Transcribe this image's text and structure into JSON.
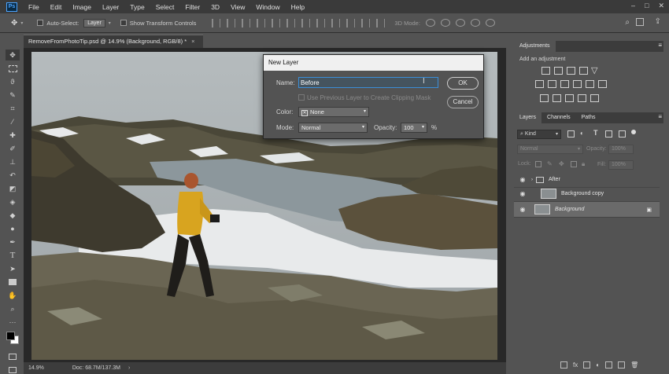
{
  "menubar": {
    "logo": "Ps",
    "items": [
      "File",
      "Edit",
      "Image",
      "Layer",
      "Type",
      "Select",
      "Filter",
      "3D",
      "View",
      "Window",
      "Help"
    ]
  },
  "options": {
    "auto_select": "Auto-Select:",
    "auto_select_target": "Layer",
    "show_transform": "Show Transform Controls",
    "mode_3d": "3D Mode:"
  },
  "document": {
    "tab_title": "RemoveFromPhotoTip.psd @ 14.9% (Background, RGB/8) *",
    "zoom": "14.9%",
    "doc_size": "Doc: 68.7M/137.3M"
  },
  "dialog": {
    "title": "New Layer",
    "name_label": "Name:",
    "name_value": "Before",
    "clip_label": "Use Previous Layer to Create Clipping Mask",
    "color_label": "Color:",
    "color_value": "None",
    "mode_label": "Mode:",
    "mode_value": "Normal",
    "opacity_label": "Opacity:",
    "opacity_value": "100",
    "opacity_unit": "%",
    "ok": "OK",
    "cancel": "Cancel"
  },
  "adjustments": {
    "tab": "Adjustments",
    "add_label": "Add an adjustment"
  },
  "layers_panel": {
    "tabs": [
      "Layers",
      "Channels",
      "Paths"
    ],
    "filter_kind": "Kind",
    "blend_mode": "Normal",
    "opacity_label": "Opacity:",
    "opacity_value": "100%",
    "lock_label": "Lock:",
    "fill_label": "Fill:",
    "fill_value": "100%",
    "layers": [
      {
        "name": "After",
        "type": "group"
      },
      {
        "name": "Background copy",
        "type": "layer"
      },
      {
        "name": "Background",
        "type": "background"
      }
    ]
  }
}
